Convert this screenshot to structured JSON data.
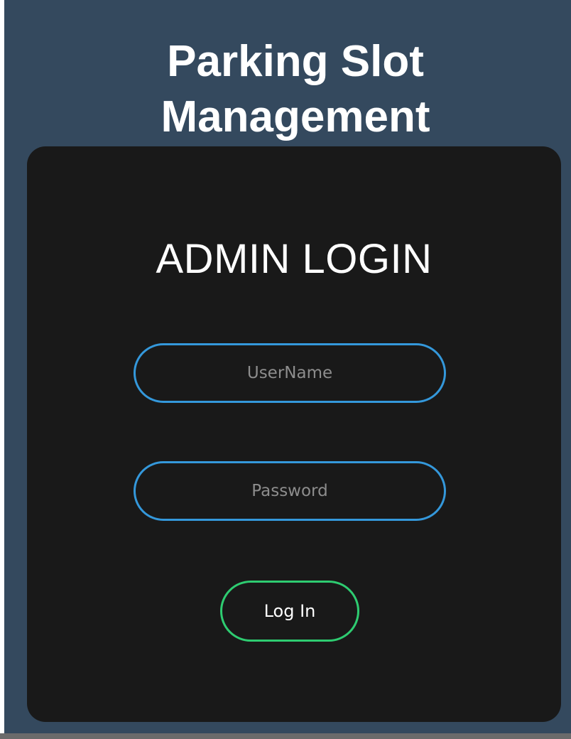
{
  "header": {
    "title_line1": "Parking Slot",
    "title_line2": "Management"
  },
  "login_form": {
    "heading": "ADMIN LOGIN",
    "username_placeholder": "UserName",
    "password_placeholder": "Password",
    "submit_label": "Log In"
  },
  "colors": {
    "page_background": "#34495e",
    "card_background": "#191919",
    "input_border": "#3498db",
    "button_border": "#2ecc71",
    "text": "#ffffff",
    "placeholder": "#8d8d8d"
  }
}
